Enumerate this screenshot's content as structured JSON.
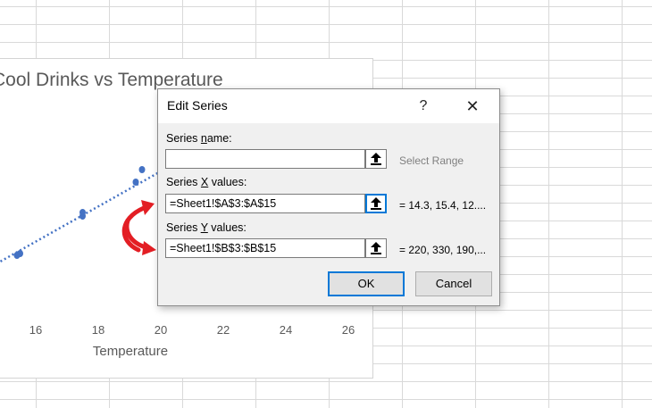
{
  "chart": {
    "title": "Cool Drinks vs Temperature",
    "x_axis_title": "Temperature",
    "x_ticks": [
      "16",
      "18",
      "20",
      "22",
      "24",
      "26"
    ]
  },
  "chart_data": {
    "type": "scatter",
    "title": "Cool Drinks vs Temperature",
    "xlabel": "Temperature",
    "ylabel": "",
    "xlim": [
      14,
      26
    ],
    "x_ticks": [
      16,
      18,
      20,
      22,
      24,
      26
    ],
    "points": [
      {
        "x": 15.4,
        "y": 0.4
      },
      {
        "x": 15.5,
        "y": 0.41
      },
      {
        "x": 17.5,
        "y": 0.62
      },
      {
        "x": 17.5,
        "y": 0.64
      },
      {
        "x": 19.2,
        "y": 0.81
      },
      {
        "x": 19.4,
        "y": 0.88
      }
    ],
    "trendline": {
      "style": "dotted",
      "color": "#4472c4",
      "from": {
        "x": 14.0,
        "y": 0.28
      },
      "to": {
        "x": 20.3,
        "y": 0.9
      }
    },
    "marker_color": "#4472c4"
  },
  "dialog": {
    "title": "Edit Series",
    "help_symbol": "?",
    "close_symbol": "✕",
    "series_name": {
      "label_pre": "Series ",
      "label_key": "n",
      "label_post": "ame:",
      "value": "",
      "preview": "Select Range"
    },
    "series_x": {
      "label_pre": "Series ",
      "label_key": "X",
      "label_post": " values:",
      "value": "=Sheet1!$A$3:$A$15",
      "preview": "= 14.3, 15.4, 12...."
    },
    "series_y": {
      "label_pre": "Series ",
      "label_key": "Y",
      "label_post": " values:",
      "value": "=Sheet1!$B$3:$B$15",
      "preview": "= 220, 330, 190,..."
    },
    "ok_label": "OK",
    "cancel_label": "Cancel"
  },
  "colors": {
    "accent": "#0078d7",
    "annotation_arrow": "#e31e24",
    "series": "#4472c4"
  }
}
